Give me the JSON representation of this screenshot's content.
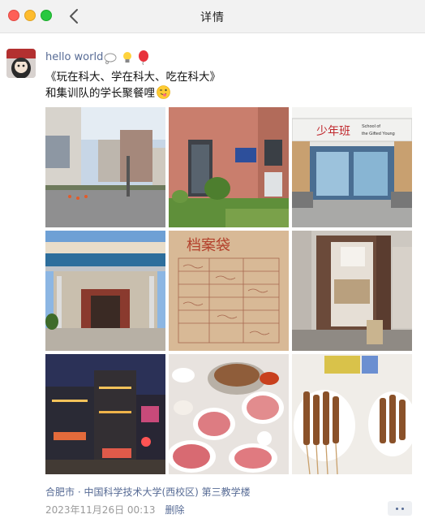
{
  "window": {
    "title": "详情",
    "controls": [
      "close-button",
      "minimize-button",
      "zoom-button"
    ],
    "back_icon": "chevron-left-icon"
  },
  "post": {
    "username": "hello world",
    "username_emojis": [
      "thought-balloon-icon",
      "light-bulb-icon",
      "balloon-icon"
    ],
    "text_line1": "《玩在科大、学在科大、吃在科大》",
    "text_line2": "和集训队的学长聚餐哩",
    "text_line2_emoji": "tongue-wink-emoji",
    "photos": [
      {
        "name": "photo-street-campus"
      },
      {
        "name": "photo-red-brick-building"
      },
      {
        "name": "photo-school-gifted-young-entrance",
        "signage_text": "少年班",
        "signage_subtext": "School of the Gifted Young"
      },
      {
        "name": "photo-building-entrance-canopy"
      },
      {
        "name": "photo-archive-bag-handwriting",
        "caption_text": "档案袋"
      },
      {
        "name": "photo-classroom-doorway"
      },
      {
        "name": "photo-night-street"
      },
      {
        "name": "photo-hotpot-meal"
      },
      {
        "name": "photo-bbq-skewers"
      }
    ],
    "location": "合肥市 · 中国科学技术大学(西校区) 第三教学楼",
    "timestamp": "2023年11月26日 00:13",
    "delete_label": "删除",
    "more_icon": "more-dots-icon"
  },
  "colors": {
    "link": "#576b95",
    "meta": "#9a9a9a",
    "titlebar_bg": "#f2f2f2"
  }
}
